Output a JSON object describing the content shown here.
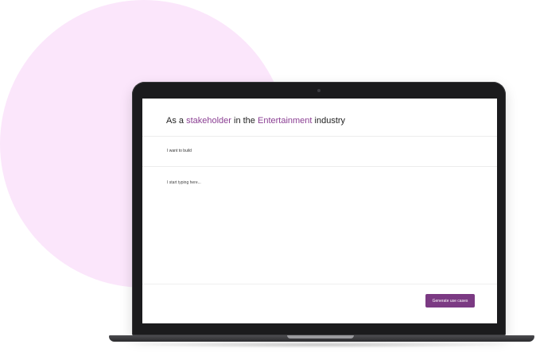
{
  "prompt": {
    "prefix": "As a ",
    "role": "stakeholder",
    "middle": " in the ",
    "industry": "Entertainment",
    "suffix": " industry"
  },
  "build_label": "I want to build",
  "textarea": {
    "placeholder": "I start typing here..."
  },
  "generate_button": "Generate use cases",
  "colors": {
    "accent": "#7b3a83",
    "background_circle": "#fbe6fb"
  }
}
